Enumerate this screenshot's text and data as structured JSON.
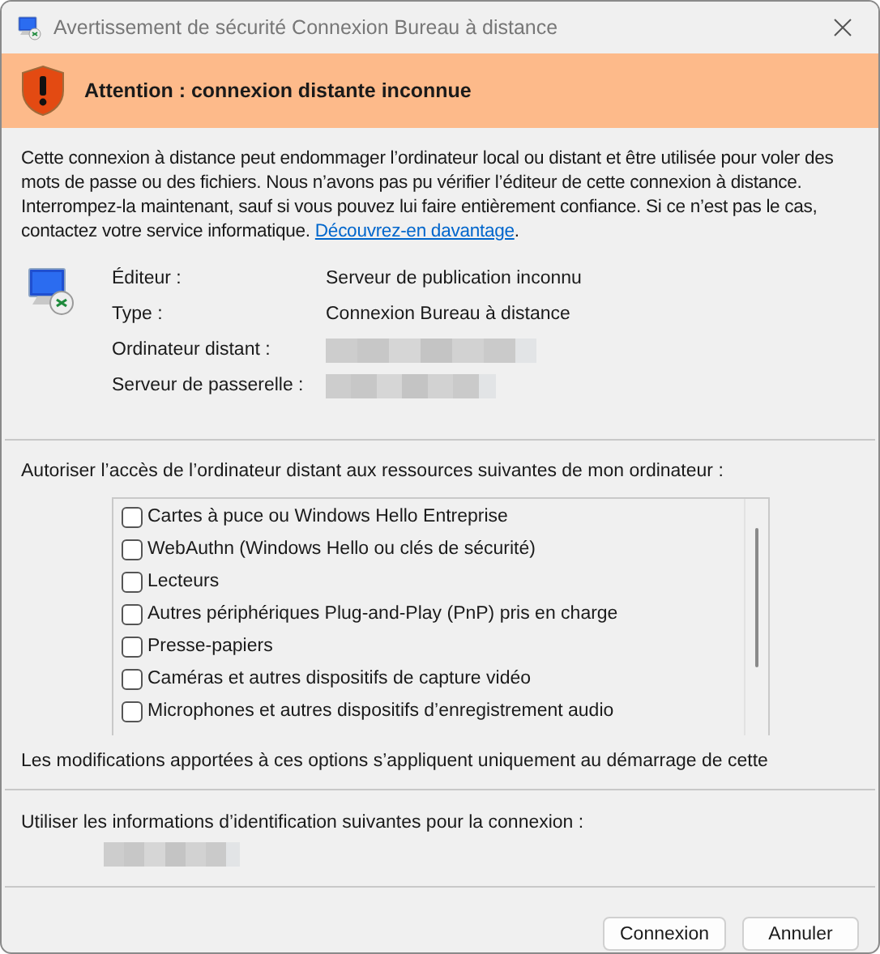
{
  "window": {
    "title": "Avertissement de sécurité Connexion Bureau à distance"
  },
  "banner": {
    "title": "Attention : connexion distante inconnue"
  },
  "message": {
    "text": "Cette connexion à distance peut endommager l’ordinateur local ou distant et être utilisée pour voler des mots de passe ou des fichiers. Nous n’avons pas pu vérifier l’éditeur de cette connexion à distance. Interrompez-la maintenant, sauf si vous pouvez lui faire entièrement confiance. Si ce n’est pas le cas, contactez votre service informatique.",
    "link": "Découvrez-en davantage",
    "after": "."
  },
  "details": [
    {
      "label": "Éditeur :",
      "kind": "text",
      "value": "Serveur de publication inconnu"
    },
    {
      "label": "Type :",
      "kind": "text",
      "value": "Connexion Bureau à distance"
    },
    {
      "label": "Ordinateur distant :",
      "kind": "redacted"
    },
    {
      "label": "Serveur de passerelle :",
      "kind": "redacted"
    }
  ],
  "permissions": {
    "label": "Autoriser l’accès de l’ordinateur distant aux ressources suivantes de mon ordinateur :",
    "items": [
      {
        "label": "Cartes à puce ou Windows Hello Entreprise",
        "checked": false
      },
      {
        "label": "WebAuthn (Windows Hello ou clés de sécurité)",
        "checked": false
      },
      {
        "label": "Lecteurs",
        "checked": false
      },
      {
        "label": "Autres périphériques Plug-and-Play (PnP) pris en charge",
        "checked": false
      },
      {
        "label": "Presse-papiers",
        "checked": false
      },
      {
        "label": "Caméras et autres dispositifs de capture vidéo",
        "checked": false
      },
      {
        "label": "Microphones et autres dispositifs d’enregistrement audio",
        "checked": false
      }
    ],
    "note": "Les modifications apportées à ces options s’appliquent uniquement au démarrage de cette"
  },
  "credentials": {
    "label": "Utiliser les informations d’identification suivantes pour la connexion :"
  },
  "buttons": [
    "Connexion",
    "Annuler"
  ]
}
